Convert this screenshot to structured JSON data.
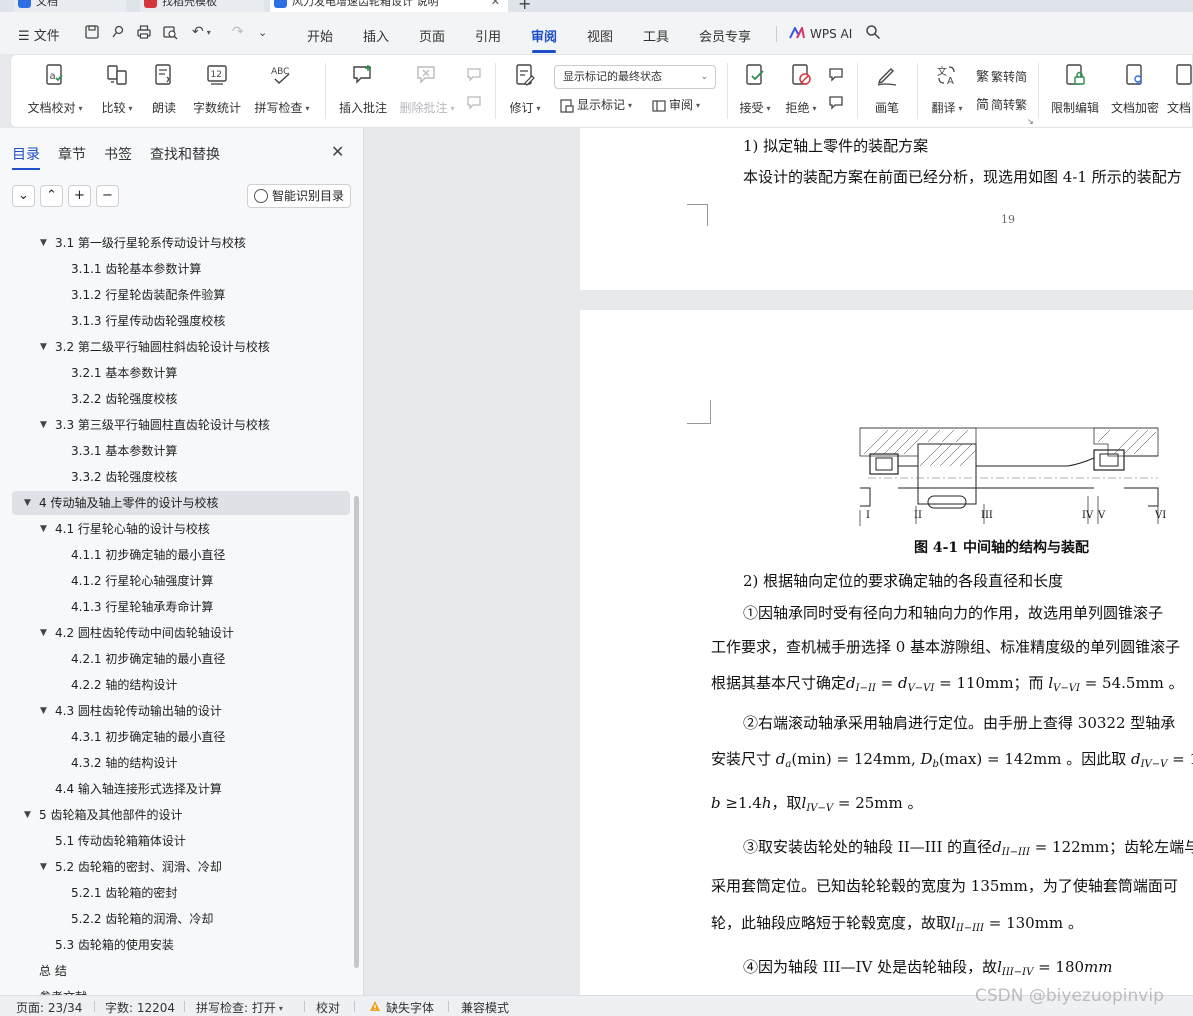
{
  "tabs": [
    {
      "label": "文档"
    },
    {
      "label": "找稻壳模板"
    },
    {
      "label": "风力发电增速齿轮箱设计 说明"
    }
  ],
  "menu": {
    "file": "文件",
    "items": [
      "开始",
      "插入",
      "页面",
      "引用",
      "审阅",
      "视图",
      "工具",
      "会员专享"
    ],
    "active": "审阅",
    "wps_ai": "WPS AI"
  },
  "ribbon": {
    "doc_check": "文档校对",
    "compare": "比较",
    "read_aloud": "朗读",
    "word_count": "字数统计",
    "spell_check": "拼写检查",
    "insert_comment": "插入批注",
    "delete_comment": "删除批注",
    "revise": "修订",
    "markup_state": "显示标记的最终状态",
    "show_markup": "显示标记",
    "review": "审阅",
    "accept": "接受",
    "reject": "拒绝",
    "ink": "画笔",
    "translate": "翻译",
    "to_traditional": "繁转简",
    "to_simplified": "简转繁",
    "restrict_edit": "限制编辑",
    "encrypt": "文档加密",
    "doc_more": "文档"
  },
  "sidebar": {
    "tabs": [
      "目录",
      "章节",
      "书签",
      "查找和替换"
    ],
    "smart_toc": "智能识别目录",
    "toc": [
      {
        "text": "3.1 第一级行星轮系传动设计与校核",
        "level": 2,
        "expand": true
      },
      {
        "text": "3.1.1 齿轮基本参数计算",
        "level": 3
      },
      {
        "text": "3.1.2 行星轮齿装配条件验算",
        "level": 3
      },
      {
        "text": "3.1.3 行星传动齿轮强度校核",
        "level": 3
      },
      {
        "text": "3.2 第二级平行轴圆柱斜齿轮设计与校核",
        "level": 2,
        "expand": true
      },
      {
        "text": "3.2.1 基本参数计算",
        "level": 3
      },
      {
        "text": "3.2.2 齿轮强度校核",
        "level": 3
      },
      {
        "text": "3.3 第三级平行轴圆柱直齿轮设计与校核",
        "level": 2,
        "expand": true
      },
      {
        "text": "3.3.1 基本参数计算",
        "level": 3
      },
      {
        "text": "3.3.2 齿轮强度校核",
        "level": 3
      },
      {
        "text": "4 传动轴及轴上零件的设计与校核",
        "level": 1,
        "expand": true,
        "selected": true
      },
      {
        "text": "4.1 行星轮心轴的设计与校核",
        "level": 2,
        "expand": true
      },
      {
        "text": "4.1.1 初步确定轴的最小直径",
        "level": 3
      },
      {
        "text": "4.1.2 行星轮心轴强度计算",
        "level": 3
      },
      {
        "text": "4.1.3 行星轮轴承寿命计算",
        "level": 3
      },
      {
        "text": "4.2 圆柱齿轮传动中间齿轮轴设计",
        "level": 2,
        "expand": true
      },
      {
        "text": "4.2.1 初步确定轴的最小直径",
        "level": 3
      },
      {
        "text": "4.2.2 轴的结构设计",
        "level": 3
      },
      {
        "text": "4.3 圆柱齿轮传动输出轴的设计",
        "level": 2,
        "expand": true
      },
      {
        "text": "4.3.1 初步确定轴的最小直径",
        "level": 3
      },
      {
        "text": "4.3.2 轴的结构设计",
        "level": 3
      },
      {
        "text": "4.4 输入轴连接形式选择及计算",
        "level": 2
      },
      {
        "text": "5 齿轮箱及其他部件的设计",
        "level": 1,
        "expand": true
      },
      {
        "text": "5.1 传动齿轮箱箱体设计",
        "level": 2
      },
      {
        "text": "5.2 齿轮箱的密封、润滑、冷却",
        "level": 2,
        "expand": true
      },
      {
        "text": "5.2.1 齿轮箱的密封",
        "level": 3
      },
      {
        "text": "5.2.2 齿轮箱的润滑、冷却",
        "level": 3
      },
      {
        "text": "5.3 齿轮箱的使用安装",
        "level": 2
      },
      {
        "text": "总  结",
        "level": 1
      },
      {
        "text": "参考文献",
        "level": 1
      }
    ]
  },
  "document": {
    "page1": {
      "heading": "1)  拟定轴上零件的装配方案",
      "para": "本设计的装配方案在前面已经分析，现选用如图 4-1 所示的装配方",
      "page_number": "19"
    },
    "figure_labels": [
      "I",
      "II",
      "III",
      "IV",
      "V",
      "VI"
    ],
    "caption": "图 4-1  中间轴的结构与装配",
    "l2_heading": "2)  根据轴向定位的要求确定轴的各段直径和长度",
    "p1_a": "①因轴承同时受有径向力和轴向力的作用，故选用单列圆锥滚子",
    "p1_b": "工作要求，查机械手册选择 0 基本游隙组、标准精度级的单列圆锥滚子",
    "p1_c_pre": "根据其基本尺寸确定",
    "p1_c_mid": "；而",
    "p1_c_end": "。",
    "p2_a": "②右端滚动轴承采用轴肩进行定位。由手册上查得 30322 型轴承",
    "p2_b_pre": "安装尺寸",
    "p2_b_mid": "。因此取",
    "p3_pre": "，取",
    "p3_end": "。",
    "p4_a_pre": "③取安装齿轮处的轴段 II—III 的直径",
    "p4_a_end": "；齿轮左端与",
    "p4_b": "采用套筒定位。已知齿轮轮毂的宽度为 135mm，为了使轴套筒端面可",
    "p4_c_pre": "轮，此轴段应略短于轮毂宽度，故取",
    "p4_c_end": "。",
    "p5_pre": "④因为轴段 III—IV 处是齿轮轴段，故"
  },
  "status": {
    "page": "页面: 23/34",
    "words": "字数: 12204",
    "spell": "拼写检查: 打开",
    "proof": "校对",
    "missing_font": "缺失字体",
    "compat": "兼容模式"
  },
  "watermark": "CSDN @biyezuopinvip"
}
